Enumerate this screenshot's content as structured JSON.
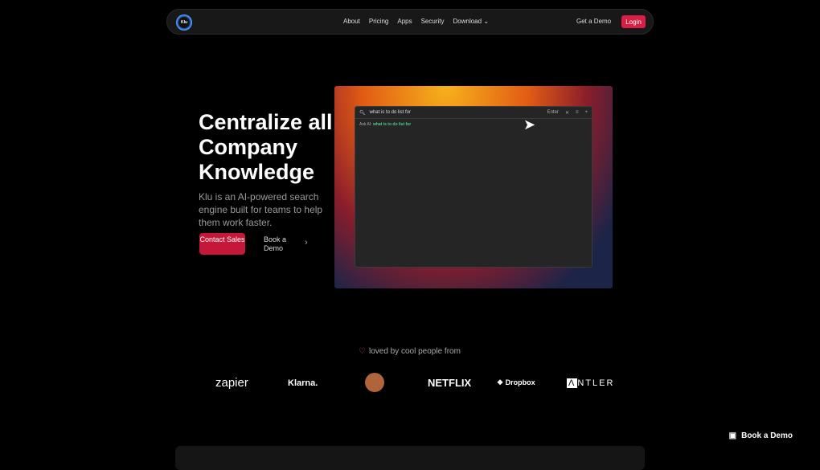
{
  "nav": {
    "logo": "Klu",
    "links": [
      "About",
      "Pricing",
      "Apps",
      "Security",
      "Download"
    ],
    "get_demo": "Get a Demo",
    "login": "Login"
  },
  "hero": {
    "title": "Centralize all Company Knowledge",
    "subtitle": "Klu is an AI-powered search engine built for teams to help them work faster.",
    "contact": "Contact Sales",
    "book": "Book a Demo"
  },
  "app": {
    "query": "what is to do list for",
    "enter": "Enter",
    "ask_label": "Ask AI:",
    "ask_query": "what is to do list for"
  },
  "loved": "loved by cool people from",
  "logos": [
    "zapier",
    "Klarna.",
    "NETFLIX",
    "Dropbox",
    "NTLER"
  ],
  "floating": "Book a Demo"
}
